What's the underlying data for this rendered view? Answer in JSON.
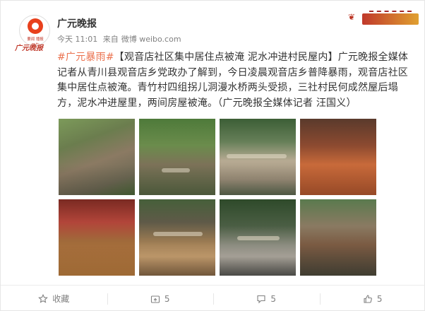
{
  "header": {
    "author": "广元晚报",
    "avatar_logo_lines": "要闻 播报 民生",
    "avatar_brand": "广元晚报",
    "meta": {
      "time": "今天 11:01",
      "source_prefix": "来自",
      "source": "微博 weibo.com"
    }
  },
  "post": {
    "topic": "#广元暴雨#",
    "text": "【观音店社区集中居住点被淹 泥水冲进村民屋内】广元晚报全媒体记者从青川县观音店乡党政办了解到，今日凌晨观音店乡普降暴雨，观音店社区集中居住点被淹。青竹村四组拐儿洞漫水桥两头受损，三社村民何成然屋后塌方，泥水冲进屋里，两间房屋被淹。（广元晚报全媒体记者 汪国义）"
  },
  "gallery": {
    "count": 8
  },
  "actions": {
    "favorite_label": "收藏",
    "repost_count": "5",
    "comment_count": "5",
    "like_count": "5"
  },
  "colors": {
    "topic": "#eb7350",
    "meta_gray": "#808080",
    "brand_red": "#e8401c"
  }
}
